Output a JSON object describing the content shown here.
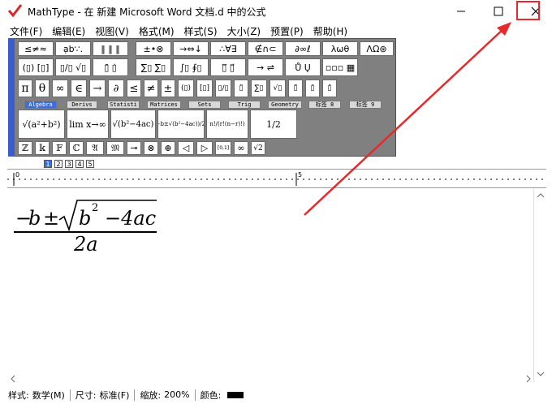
{
  "window": {
    "title": "MathType - 在 新建 Microsoft Word 文档.d 中的公式",
    "accent": "#e8292b"
  },
  "menu": [
    "文件(F)",
    "编辑(E)",
    "视图(V)",
    "格式(M)",
    "样式(S)",
    "大小(Z)",
    "预置(P)",
    "帮助(H)"
  ],
  "palette_row1": [
    "≤≠≈",
    "ạb∵.",
    "‖ ‖ ‖",
    "±•⊗",
    "→⇔↓",
    "∴∀∃",
    "∉∩⊂",
    "∂∞ℓ",
    "λωθ",
    "ΛΩ⊛"
  ],
  "palette_row2": [
    "(▯) [▯]",
    "▯/▯ √▯",
    "▯̄ ▯̇",
    "∑▯ ∑▯",
    "∫▯ ∮▯",
    "▯̅ ▯⃗",
    "→ ⇌",
    "Ů Ų",
    "▫▫▫ ▦"
  ],
  "palette_row3": [
    "π",
    "θ",
    "∞",
    "∈",
    "→",
    "∂",
    "≤",
    "≠",
    "±",
    "(▯)",
    "[▯]",
    "▯/▯",
    "▯̈",
    "∑▯",
    "√▯",
    "▯̃",
    "▯̄",
    "▯̂"
  ],
  "tabs": [
    "Algebra",
    "Derivs",
    "Statisti",
    "Matrices",
    "Sets",
    "Trig",
    "Geometry",
    "标签 8",
    "标签 9"
  ],
  "templates": [
    "√(a²+b²)",
    "lim x→∞",
    "√(b²−4ac)",
    "(−b±√(b²−4ac))/2a",
    "n!/(r!(n−r)!)",
    "1/2"
  ],
  "palette_row5": [
    "ℤ",
    "𝕜",
    "𝔽",
    "ℂ",
    "𝔄",
    "𝔐",
    "⊸",
    "⊗",
    "⊕",
    "◁",
    "▷",
    "[0,1]",
    "∞",
    "√2"
  ],
  "size_buttons": [
    "1",
    "2",
    "3",
    "4",
    "5"
  ],
  "ruler": {
    "label0": "0",
    "label5": "5"
  },
  "equation": {
    "numerator_minus": "−",
    "b": "b",
    "pm": "±",
    "radicand": "b",
    "exponent": "2",
    "rest": "−4ac",
    "denominator": "2a"
  },
  "status": {
    "style_label": "样式:",
    "style_value": "数学(M)",
    "size_label": "尺寸:",
    "size_value": "标准(F)",
    "zoom_label": "缩放:",
    "zoom_value": "200%",
    "color_label": "颜色:"
  }
}
